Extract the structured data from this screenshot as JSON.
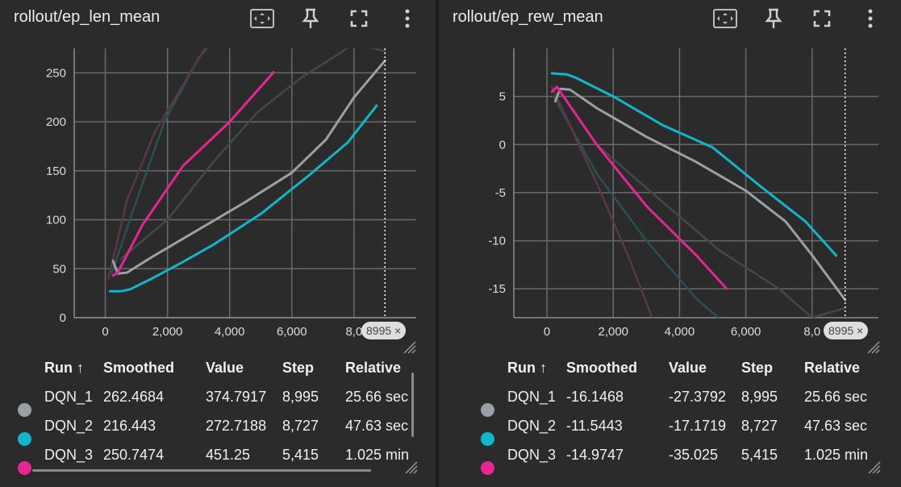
{
  "panels": [
    {
      "id": "left",
      "title": "rollout/ep_len_mean",
      "step_chip": "8995 ×",
      "table": {
        "headers": [
          "Run ↑",
          "Smoothed",
          "Value",
          "Step",
          "Relative"
        ],
        "rows": [
          [
            "DQN_1",
            "262.4684",
            "374.7917",
            "8,995",
            "25.66 sec"
          ],
          [
            "DQN_2",
            "216.443",
            "272.7188",
            "8,727",
            "47.63 sec"
          ],
          [
            "DQN_3",
            "250.7474",
            "451.25",
            "5,415",
            "1.025 min"
          ]
        ]
      }
    },
    {
      "id": "right",
      "title": "rollout/ep_rew_mean",
      "step_chip": "8995 ×",
      "table": {
        "headers": [
          "Run ↑",
          "Smoothed",
          "Value",
          "Step",
          "Relative"
        ],
        "rows": [
          [
            "DQN_1",
            "-16.1468",
            "-27.3792",
            "8,995",
            "25.66 sec"
          ],
          [
            "DQN_2",
            "-11.5443",
            "-17.1719",
            "8,727",
            "47.63 sec"
          ],
          [
            "DQN_3",
            "-14.9747",
            "-35.025",
            "5,415",
            "1.025 min"
          ]
        ]
      }
    }
  ],
  "run_colors": {
    "DQN_1": "#9aa0a6",
    "DQN_2": "#12b5cb",
    "DQN_3": "#e52592"
  },
  "faded_colors": {
    "DQN_1": "#3f4a4c",
    "DQN_2": "#2a5054",
    "DQN_3": "#5a3845"
  },
  "chart_data": [
    {
      "type": "line",
      "title": "rollout/ep_len_mean",
      "xlim": [
        -1000,
        10000
      ],
      "ylim": [
        0,
        275
      ],
      "x_ticks": [
        0,
        2000,
        4000,
        6000,
        8000
      ],
      "x_tick_labels": [
        "0",
        "2,000",
        "4,000",
        "6,000",
        "8,0"
      ],
      "y_ticks": [
        0,
        50,
        100,
        150,
        200,
        250
      ],
      "y_tick_labels": [
        "0",
        "50",
        "100",
        "150",
        "200",
        "250"
      ],
      "grid": true,
      "cursor_step": 8995,
      "series": [
        {
          "name": "DQN_1",
          "kind": "raw",
          "x": [
            500,
            2000,
            3500,
            4900,
            6300,
            7300,
            8000,
            8995
          ],
          "y": [
            60,
            100,
            160,
            210,
            245,
            265,
            280,
            272
          ]
        },
        {
          "name": "DQN_2",
          "kind": "raw",
          "x": [
            200,
            900,
            1900,
            3000,
            3400
          ],
          "y": [
            45,
            110,
            200,
            265,
            280
          ]
        },
        {
          "name": "DQN_3",
          "kind": "raw",
          "x": [
            100,
            700,
            1600,
            3300
          ],
          "y": [
            40,
            120,
            190,
            280
          ]
        },
        {
          "name": "DQN_1",
          "kind": "smoothed",
          "x": [
            250,
            400,
            700,
            1500,
            3000,
            4500,
            6000,
            7100,
            8000,
            8995
          ],
          "y": [
            58,
            45,
            46,
            62,
            90,
            118,
            148,
            182,
            225,
            262.4684
          ]
        },
        {
          "name": "DQN_2",
          "kind": "smoothed",
          "x": [
            150,
            500,
            800,
            1500,
            2500,
            3500,
            5000,
            6500,
            7800,
            8727
          ],
          "y": [
            27,
            27,
            29,
            40,
            57,
            75,
            106,
            144,
            179,
            216.443
          ]
        },
        {
          "name": "DQN_3",
          "kind": "smoothed",
          "x": [
            250,
            400,
            1200,
            2500,
            4000,
            5415
          ],
          "y": [
            43,
            46,
            95,
            155,
            200,
            250.7474
          ]
        }
      ]
    },
    {
      "type": "line",
      "title": "rollout/ep_rew_mean",
      "xlim": [
        -1000,
        10000
      ],
      "ylim": [
        -18,
        10
      ],
      "x_ticks": [
        0,
        2000,
        4000,
        6000,
        8000
      ],
      "x_tick_labels": [
        "0",
        "2,000",
        "4,000",
        "6,000",
        "8,0"
      ],
      "y_ticks": [
        5,
        0,
        -5,
        -10,
        -15
      ],
      "y_tick_labels": [
        "5",
        "0",
        "-5",
        "-10",
        "-15"
      ],
      "grid": true,
      "cursor_step": 8995,
      "series": [
        {
          "name": "DQN_1",
          "kind": "raw",
          "x": [
            300,
            1500,
            3500,
            5200,
            7000,
            8000,
            8995
          ],
          "y": [
            6,
            0,
            -6,
            -11,
            -15,
            -18,
            -17
          ]
        },
        {
          "name": "DQN_2",
          "kind": "raw",
          "x": [
            200,
            1500,
            3000,
            4500,
            5500
          ],
          "y": [
            5,
            -3,
            -10,
            -16,
            -19
          ]
        },
        {
          "name": "DQN_3",
          "kind": "raw",
          "x": [
            150,
            1500,
            2500,
            3400
          ],
          "y": [
            6,
            -4,
            -12,
            -20
          ]
        },
        {
          "name": "DQN_1",
          "kind": "smoothed",
          "x": [
            250,
            400,
            700,
            1500,
            3000,
            4500,
            6000,
            7200,
            8000,
            8995
          ],
          "y": [
            4.5,
            5.8,
            5.7,
            3.8,
            0.8,
            -1.8,
            -4.8,
            -8,
            -11.5,
            -16.1468
          ]
        },
        {
          "name": "DQN_2",
          "kind": "smoothed",
          "x": [
            150,
            600,
            900,
            2000,
            3500,
            5000,
            6500,
            7800,
            8727
          ],
          "y": [
            7.4,
            7.3,
            6.9,
            5,
            2,
            -0.3,
            -4.5,
            -8,
            -11.5443
          ]
        },
        {
          "name": "DQN_3",
          "kind": "smoothed",
          "x": [
            150,
            300,
            1500,
            3000,
            4500,
            5415
          ],
          "y": [
            5.5,
            6,
            0,
            -6.4,
            -11.5,
            -14.9747
          ]
        }
      ]
    }
  ]
}
